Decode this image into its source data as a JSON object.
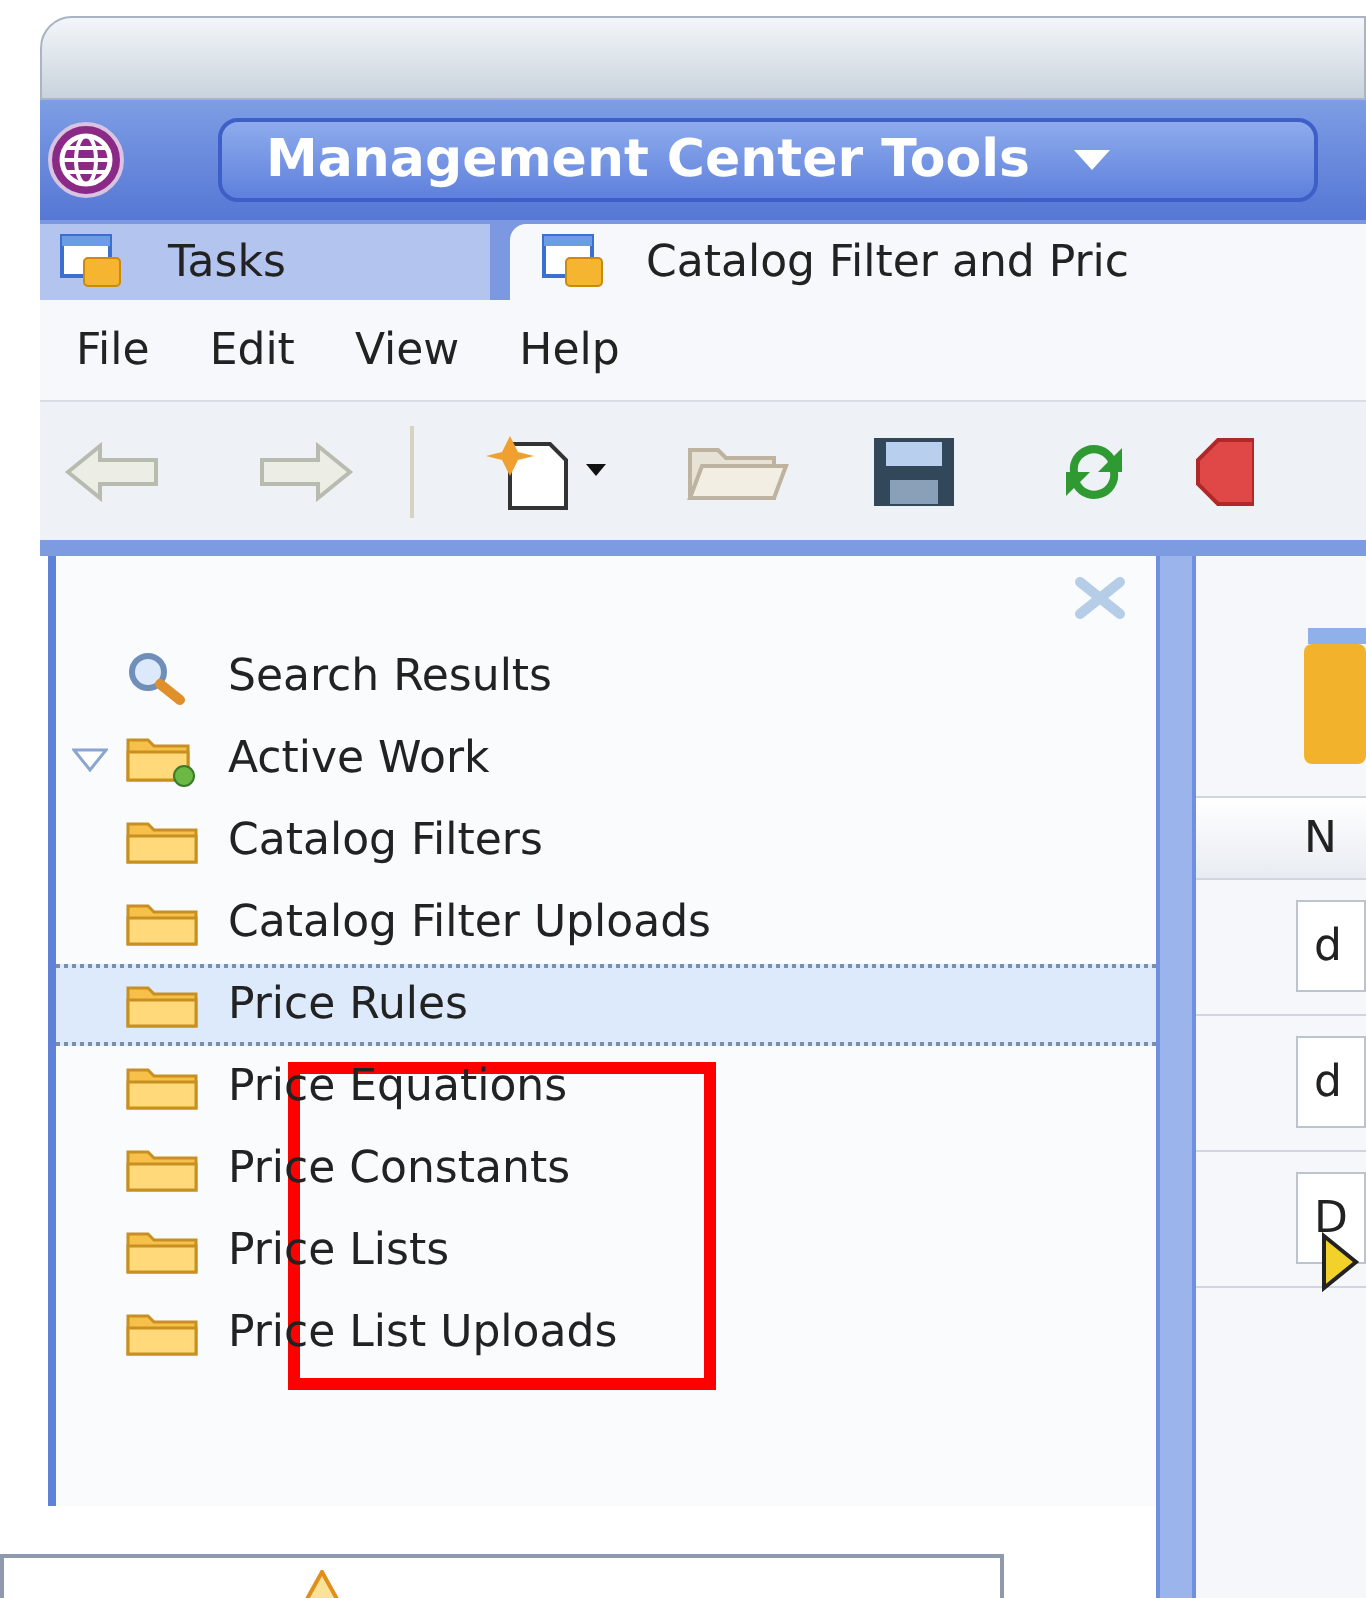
{
  "app_switcher": {
    "label": "Management Center Tools"
  },
  "tabs": [
    {
      "label": "Tasks",
      "selected": false
    },
    {
      "label": "Catalog Filter and Pric",
      "selected": true
    }
  ],
  "menu": [
    "File",
    "Edit",
    "View",
    "Help"
  ],
  "tree": [
    {
      "label": "Search Results",
      "kind": "search",
      "expanded": false,
      "selected": false
    },
    {
      "label": "Active Work",
      "kind": "active",
      "expanded": true,
      "selected": false
    },
    {
      "label": "Catalog Filters",
      "kind": "folder",
      "expanded": false,
      "selected": false
    },
    {
      "label": "Catalog Filter Uploads",
      "kind": "folder",
      "expanded": false,
      "selected": false
    },
    {
      "label": "Price Rules",
      "kind": "folder",
      "expanded": false,
      "selected": true
    },
    {
      "label": "Price Equations",
      "kind": "folder",
      "expanded": false,
      "selected": false
    },
    {
      "label": "Price Constants",
      "kind": "folder",
      "expanded": false,
      "selected": false
    },
    {
      "label": "Price Lists",
      "kind": "folder",
      "expanded": false,
      "selected": false
    },
    {
      "label": "Price List Uploads",
      "kind": "folder",
      "expanded": false,
      "selected": false
    }
  ],
  "list": {
    "column_1": "N",
    "rows": [
      {
        "text": "d",
        "pointer": false
      },
      {
        "text": "d",
        "pointer": false
      },
      {
        "text": "D",
        "pointer": true
      }
    ]
  }
}
